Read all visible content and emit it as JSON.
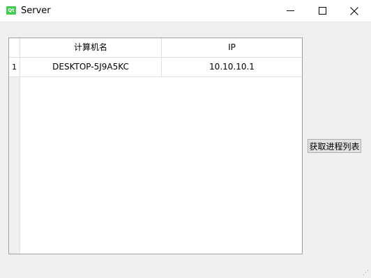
{
  "window": {
    "title": "Server",
    "logo_text": "Qt",
    "minimize_icon": "minimize-icon",
    "maximize_icon": "maximize-icon",
    "close_icon": "close-icon"
  },
  "table": {
    "columns": [
      "计算机名",
      "IP"
    ],
    "rows": [
      {
        "index": "1",
        "computer_name": "DESKTOP-5J9A5KC",
        "ip": "10.10.10.1"
      }
    ]
  },
  "actions": {
    "fetch_processes_label": "获取进程列表"
  },
  "colors": {
    "window_bg": "#f0f0f0",
    "table_bg": "#ffffff",
    "qt_green": "#41cd52",
    "button_bg": "#e1e1e1"
  }
}
